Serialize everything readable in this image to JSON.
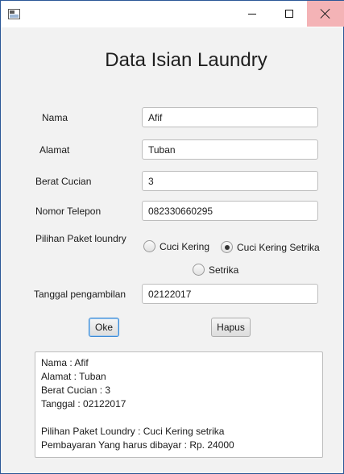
{
  "window": {
    "title": "",
    "controls": {
      "minimize": "minimize",
      "maximize": "maximize",
      "close": "close"
    }
  },
  "heading": "Data Isian Laundry",
  "form": {
    "nama_label": "Nama",
    "nama_value": "Afif",
    "alamat_label": "Alamat",
    "alamat_value": "Tuban",
    "berat_label": "Berat Cucian",
    "berat_value": "3",
    "telepon_label": "Nomor Telepon",
    "telepon_value": "082330660295",
    "paket_label": "Pilihan Paket loundry",
    "paket_options": [
      {
        "label": "Cuci Kering",
        "selected": false
      },
      {
        "label": "Cuci Kering Setrika",
        "selected": true
      },
      {
        "label": "Setrika",
        "selected": false
      }
    ],
    "tanggal_label": "Tanggal pengambilan",
    "tanggal_value": "02122017"
  },
  "buttons": {
    "oke": "Oke",
    "hapus": "Hapus"
  },
  "output": {
    "lines": [
      "Nama : Afif",
      "Alamat : Tuban",
      "Berat Cucian : 3",
      "Tanggal : 02122017",
      "",
      "Pilihan Paket Loundry : Cuci Kering setrika",
      "Pembayaran Yang harus dibayar : Rp. 24000"
    ]
  }
}
